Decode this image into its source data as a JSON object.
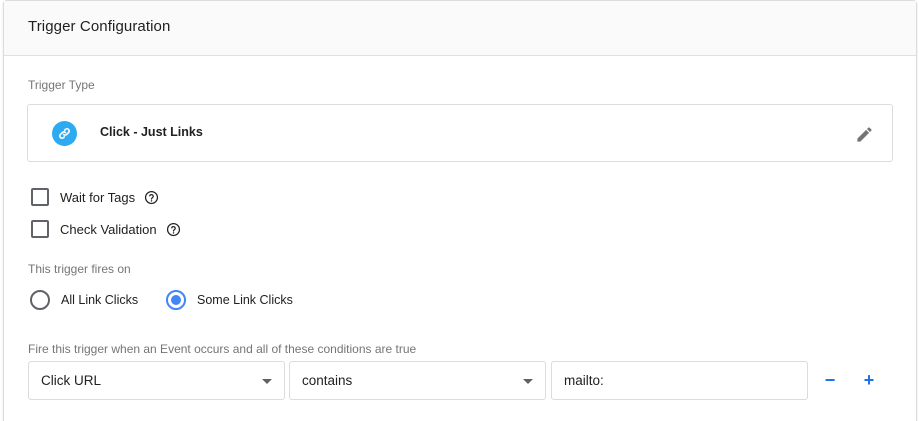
{
  "header": {
    "title": "Trigger Configuration"
  },
  "trigger_type": {
    "section_label": "Trigger Type",
    "name": "Click - Just Links",
    "icon": "link-icon",
    "icon_color": "#2eaaf1",
    "edit_icon": "pencil-icon"
  },
  "options": [
    {
      "label": "Wait for Tags",
      "checked": false,
      "help_icon": "help-icon"
    },
    {
      "label": "Check Validation",
      "checked": false,
      "help_icon": "help-icon"
    }
  ],
  "fires_on": {
    "section_label": "This trigger fires on",
    "choices": [
      {
        "label": "All Link Clicks",
        "selected": false
      },
      {
        "label": "Some Link Clicks",
        "selected": true
      }
    ]
  },
  "condition": {
    "section_label": "Fire this trigger when an Event occurs and all of these conditions are true",
    "variable": "Click URL",
    "operator": "contains",
    "value": "mailto:",
    "remove_label": "−",
    "add_label": "+"
  },
  "colors": {
    "accent": "#4285f4",
    "button_blue": "#1a73e8"
  }
}
